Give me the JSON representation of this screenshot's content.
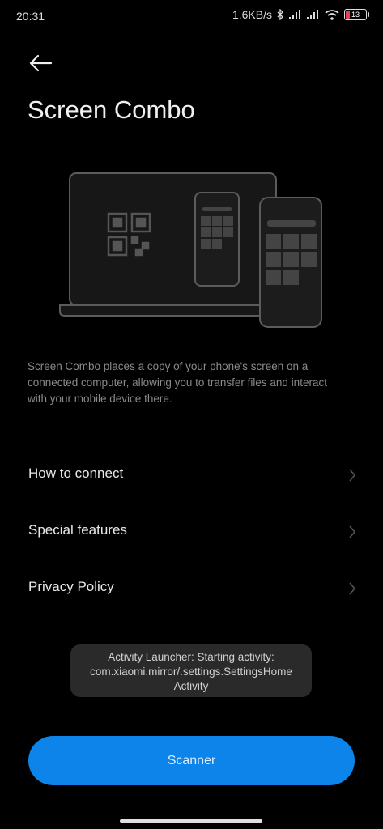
{
  "status_bar": {
    "time": "20:31",
    "net_speed": "1.6KB/s",
    "battery_level": "13",
    "icons": [
      "bluetooth-icon",
      "signal-icon",
      "signal-icon",
      "wifi-icon",
      "battery-icon"
    ]
  },
  "header": {
    "back_icon": "back-arrow-icon",
    "title": "Screen Combo"
  },
  "illustration": {
    "description_icons": [
      "laptop-icon",
      "qr-code-icon",
      "phone-icon"
    ]
  },
  "description": "Screen Combo places a copy of your phone's screen on a connected computer, allowing you to transfer files and interact with your mobile device there.",
  "menu": [
    {
      "label": "How to connect",
      "icon": "chevron-right-icon"
    },
    {
      "label": "Special features",
      "icon": "chevron-right-icon"
    },
    {
      "label": "Privacy Policy",
      "icon": "chevron-right-icon"
    }
  ],
  "toast": {
    "line1": "Activity Launcher: Starting activity:",
    "line2": "com.xiaomi.mirror/.settings.SettingsHome",
    "line3": "Activity"
  },
  "primary_button": {
    "label": "Scanner"
  },
  "colors": {
    "background": "#000000",
    "accent": "#0d84ea",
    "toast_bg": "#2a2a2a",
    "battery_low": "#e0454b"
  }
}
